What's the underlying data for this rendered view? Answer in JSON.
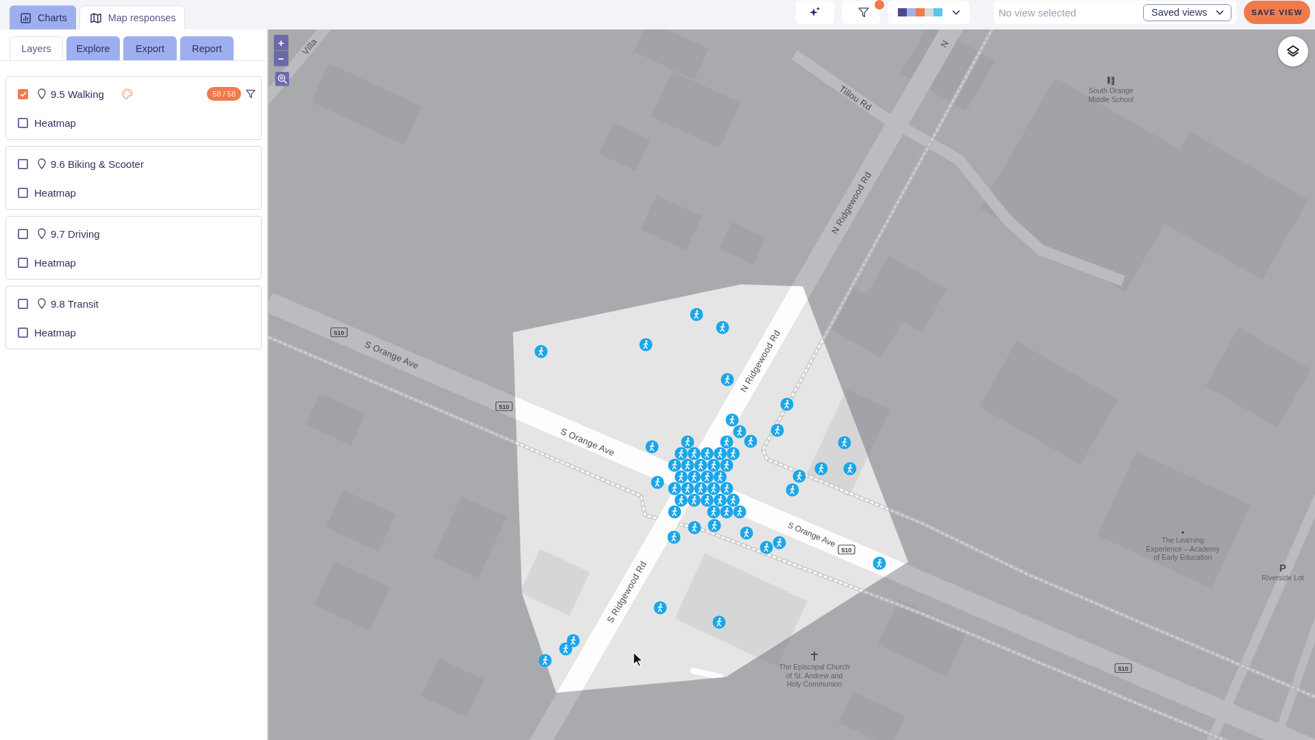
{
  "top_bar": {
    "view_tabs": [
      {
        "label": "Charts",
        "selected": false
      },
      {
        "label": "Map responses",
        "selected": true
      }
    ],
    "filter_active": true,
    "palette": {
      "swatches": [
        {
          "color": "#4b4a8e"
        },
        {
          "color": "#9fb0ee"
        },
        {
          "color": "#ef7b4b"
        },
        {
          "color": "#d9d9d9"
        },
        {
          "color": "#5ec2ee"
        }
      ]
    },
    "view_selector": {
      "placeholder": "No view selected",
      "saved_views": "Saved views"
    },
    "save_button": "SAVE VIEW"
  },
  "sidebar": {
    "panel_tabs": [
      {
        "label": "Layers",
        "selected": true
      },
      {
        "label": "Explore",
        "selected": false
      },
      {
        "label": "Export",
        "selected": false
      },
      {
        "label": "Report",
        "selected": false
      }
    ],
    "layers": [
      {
        "name": "9.5 Walking",
        "checked": true,
        "count": "58 / 58",
        "heatmap": {
          "label": "Heatmap",
          "checked": false
        }
      },
      {
        "name": "9.6 Biking & Scooter",
        "checked": false,
        "heatmap": {
          "label": "Heatmap",
          "checked": false
        }
      },
      {
        "name": "9.7 Driving",
        "checked": false,
        "heatmap": {
          "label": "Heatmap",
          "checked": false
        }
      },
      {
        "name": "9.8 Transit",
        "checked": false,
        "heatmap": {
          "label": "Heatmap",
          "checked": false
        }
      }
    ]
  },
  "map": {
    "zoom_controls": [
      "+",
      "−"
    ],
    "street_labels": [
      "Villa",
      "N",
      "Tillou Rd",
      "N Ridgewood Rd",
      "S Orange Ave",
      "N Ridgewood Rd",
      "S Orange Ave",
      "S Orange Ave",
      "S Ridgewood Rd"
    ],
    "route_shields": [
      "510",
      "510",
      "510",
      "510"
    ],
    "places": [
      {
        "lines": [
          "South Orange",
          "Middle School"
        ]
      },
      {
        "lines": [
          "The Learning",
          "Experience – Academy",
          "of Early Education"
        ]
      },
      {
        "symbol": "P",
        "lines": [
          "Riverside Lot"
        ]
      },
      {
        "lines": [
          "The Episcopal Church",
          "of St. Andrew and",
          "Holy Communion"
        ]
      }
    ]
  }
}
